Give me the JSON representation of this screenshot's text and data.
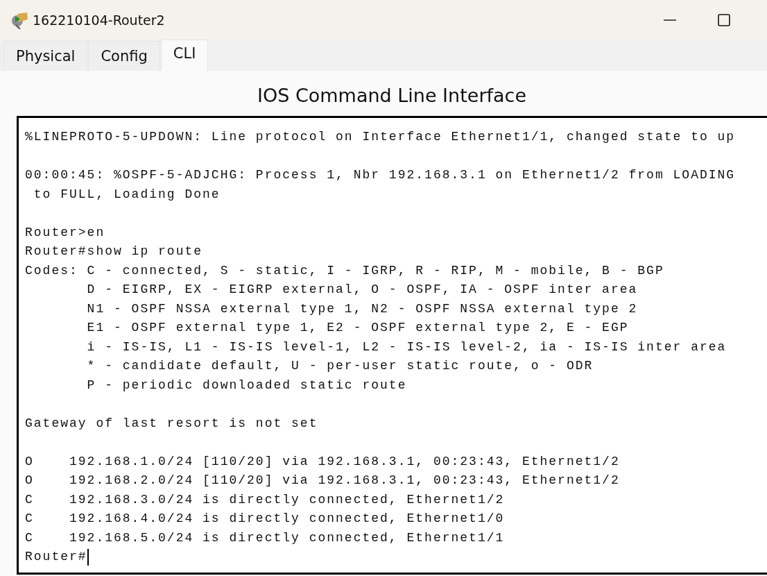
{
  "window": {
    "title": "162210104-Router2"
  },
  "tabs": [
    {
      "label": "Physical",
      "selected": false
    },
    {
      "label": "Config",
      "selected": false
    },
    {
      "label": "CLI",
      "selected": true
    }
  ],
  "heading": "IOS Command Line Interface",
  "console": {
    "blocks": [
      [
        "%LINEPROTO-5-UPDOWN: Line protocol on Interface Ethernet1/1, changed state to up"
      ],
      [
        "00:00:45: %OSPF-5-ADJCHG: Process 1, Nbr 192.168.3.1 on Ethernet1/2 from LOADING",
        " to FULL, Loading Done"
      ],
      [
        "Router>en",
        "Router#show ip route",
        "Codes: C - connected, S - static, I - IGRP, R - RIP, M - mobile, B - BGP",
        "       D - EIGRP, EX - EIGRP external, O - OSPF, IA - OSPF inter area",
        "       N1 - OSPF NSSA external type 1, N2 - OSPF NSSA external type 2",
        "       E1 - OSPF external type 1, E2 - OSPF external type 2, E - EGP",
        "       i - IS-IS, L1 - IS-IS level-1, L2 - IS-IS level-2, ia - IS-IS inter area",
        "       * - candidate default, U - per-user static route, o - ODR",
        "       P - periodic downloaded static route"
      ],
      [
        "Gateway of last resort is not set"
      ],
      [
        "O    192.168.1.0/24 [110/20] via 192.168.3.1, 00:23:43, Ethernet1/2",
        "O    192.168.2.0/24 [110/20] via 192.168.3.1, 00:23:43, Ethernet1/2",
        "C    192.168.3.0/24 is directly connected, Ethernet1/2",
        "C    192.168.4.0/24 is directly connected, Ethernet1/0",
        "C    192.168.5.0/24 is directly connected, Ethernet1/1"
      ]
    ],
    "prompt": "Router#"
  }
}
